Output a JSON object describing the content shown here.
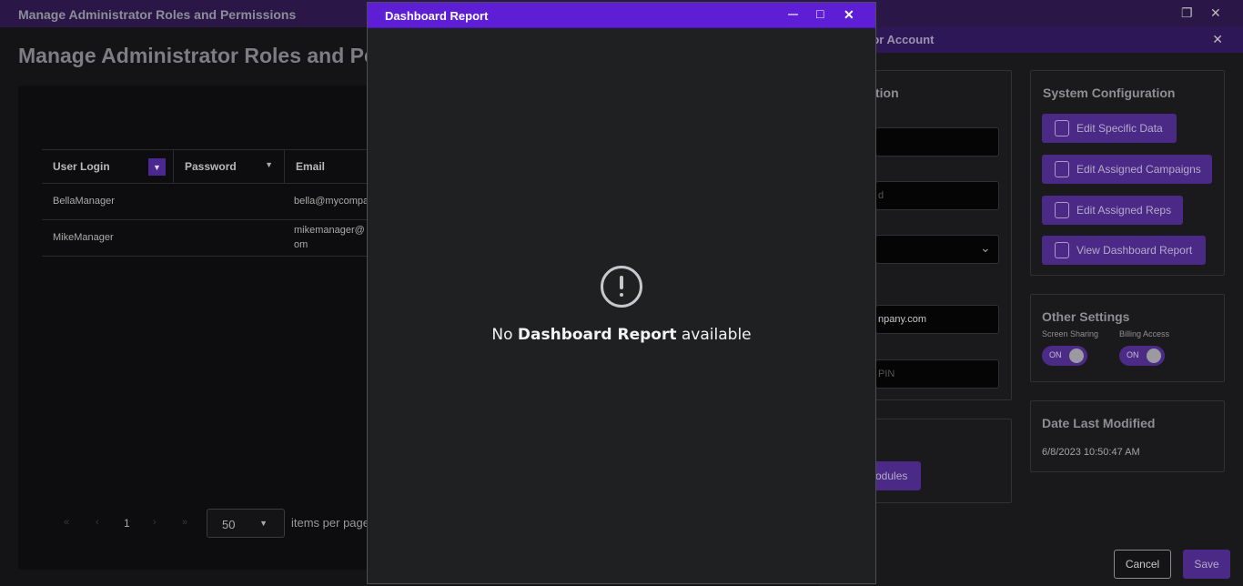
{
  "back_window": {
    "title": "Manage Administrator Roles and Permissions",
    "restore_icon": "❐",
    "close_icon": "✕",
    "page_title": "Manage Administrator Roles and Pe",
    "grid": {
      "columns": [
        "User Login",
        "Password",
        "Email"
      ],
      "filter_icon": "▼",
      "rows": [
        {
          "login": "BellaManager",
          "password": "",
          "email": "bella@mycompa"
        },
        {
          "login": "MikeManager",
          "password": "",
          "email_line1": "mikemanager@",
          "email_line2": "om"
        }
      ]
    },
    "pager": {
      "first": "«",
      "prev": "‹",
      "next": "›",
      "last": "»",
      "current_page": "1",
      "page_size": "50",
      "page_size_caret": "▼",
      "items_per_page": "items per page"
    }
  },
  "edit_window": {
    "title": "tor Account",
    "close_icon": "✕",
    "section_title_partial": "tion",
    "fields": {
      "password_placeholder": "d",
      "select_caret": "⌄",
      "email_value": "npany.com",
      "pin_placeholder": "PIN"
    },
    "modules_button": "odules",
    "system_configuration": {
      "title": "System Configuration",
      "buttons": [
        "Edit Specific Data",
        "Edit Assigned Campaigns",
        "Edit Assigned Reps",
        "View Dashboard Report"
      ]
    },
    "other_settings": {
      "title": "Other Settings",
      "screen_sharing_label": "Screen Sharing",
      "screen_sharing_state": "ON",
      "billing_access_label": "Billing Access",
      "billing_access_state": "ON"
    },
    "date_last_modified": {
      "title": "Date Last Modified",
      "value": "6/8/2023 10:50:47 AM"
    },
    "cancel_label": "Cancel",
    "save_label": "Save"
  },
  "dialog": {
    "title": "Dashboard Report",
    "minimize_icon": "—",
    "maximize_icon": "□",
    "close_icon": "✕",
    "message_prefix": "No",
    "message_bold": "Dashboard Report",
    "message_suffix": "available"
  },
  "colors": {
    "accent": "#5d1ed5",
    "button_purple": "#4a2a86",
    "background": "#141416"
  }
}
